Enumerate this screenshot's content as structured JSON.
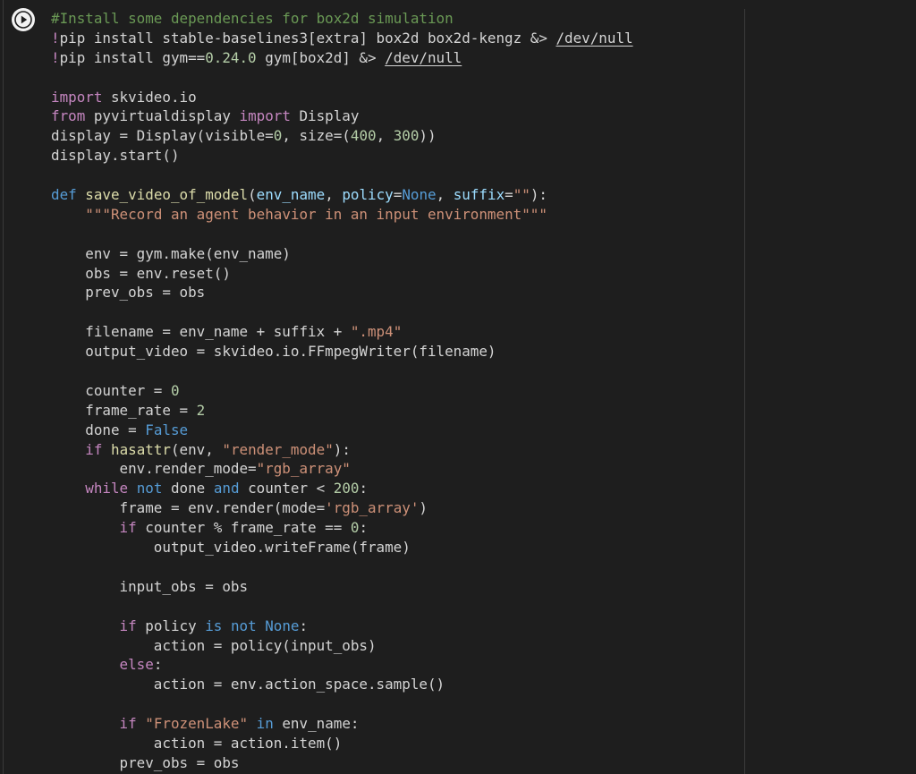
{
  "cell": {
    "run_button_label": "Run cell",
    "lines": [
      [
        {
          "t": "#Install some dependencies for box2d simulation",
          "c": "comment"
        }
      ],
      [
        {
          "t": "!",
          "c": "keyword"
        },
        {
          "t": "pip install stable-baselines3[extra] box2d box2d-kengz &> ",
          "c": "text"
        },
        {
          "t": "/dev/null",
          "c": "path"
        }
      ],
      [
        {
          "t": "!",
          "c": "keyword"
        },
        {
          "t": "pip install gym==",
          "c": "text"
        },
        {
          "t": "0.24.0",
          "c": "number"
        },
        {
          "t": " gym[box2d] &> ",
          "c": "text"
        },
        {
          "t": "/dev/null",
          "c": "path"
        }
      ],
      [],
      [
        {
          "t": "import",
          "c": "keyword"
        },
        {
          "t": " skvideo.io",
          "c": "text"
        }
      ],
      [
        {
          "t": "from",
          "c": "keyword"
        },
        {
          "t": " pyvirtualdisplay ",
          "c": "text"
        },
        {
          "t": "import",
          "c": "keyword"
        },
        {
          "t": " Display",
          "c": "text"
        }
      ],
      [
        {
          "t": "display = Display(visible=",
          "c": "text"
        },
        {
          "t": "0",
          "c": "number"
        },
        {
          "t": ", size=(",
          "c": "text"
        },
        {
          "t": "400",
          "c": "number"
        },
        {
          "t": ", ",
          "c": "text"
        },
        {
          "t": "300",
          "c": "number"
        },
        {
          "t": "))",
          "c": "text"
        }
      ],
      [
        {
          "t": "display.start()",
          "c": "text"
        }
      ],
      [],
      [
        {
          "t": "def",
          "c": "def"
        },
        {
          "t": " ",
          "c": "text"
        },
        {
          "t": "save_video_of_model",
          "c": "func"
        },
        {
          "t": "(",
          "c": "text"
        },
        {
          "t": "env_name",
          "c": "param"
        },
        {
          "t": ", ",
          "c": "text"
        },
        {
          "t": "policy",
          "c": "param"
        },
        {
          "t": "=",
          "c": "text"
        },
        {
          "t": "None",
          "c": "const"
        },
        {
          "t": ", ",
          "c": "text"
        },
        {
          "t": "suffix",
          "c": "param"
        },
        {
          "t": "=",
          "c": "text"
        },
        {
          "t": "\"\"",
          "c": "string"
        },
        {
          "t": "):",
          "c": "text"
        }
      ],
      [
        {
          "t": "    ",
          "c": "text"
        },
        {
          "t": "\"\"\"Record an agent behavior in an input environment\"\"\"",
          "c": "string"
        }
      ],
      [],
      [
        {
          "t": "    env = gym.make(env_name)",
          "c": "text"
        }
      ],
      [
        {
          "t": "    obs = env.reset()",
          "c": "text"
        }
      ],
      [
        {
          "t": "    prev_obs = obs",
          "c": "text"
        }
      ],
      [],
      [
        {
          "t": "    filename = env_name + suffix + ",
          "c": "text"
        },
        {
          "t": "\".mp4\"",
          "c": "string"
        }
      ],
      [
        {
          "t": "    output_video = skvideo.io.FFmpegWriter(filename)",
          "c": "text"
        }
      ],
      [],
      [
        {
          "t": "    counter = ",
          "c": "text"
        },
        {
          "t": "0",
          "c": "number"
        }
      ],
      [
        {
          "t": "    frame_rate = ",
          "c": "text"
        },
        {
          "t": "2",
          "c": "number"
        }
      ],
      [
        {
          "t": "    done = ",
          "c": "text"
        },
        {
          "t": "False",
          "c": "const"
        }
      ],
      [
        {
          "t": "    ",
          "c": "text"
        },
        {
          "t": "if",
          "c": "keyword"
        },
        {
          "t": " ",
          "c": "text"
        },
        {
          "t": "hasattr",
          "c": "func"
        },
        {
          "t": "(env, ",
          "c": "text"
        },
        {
          "t": "\"render_mode\"",
          "c": "string"
        },
        {
          "t": "):",
          "c": "text"
        }
      ],
      [
        {
          "t": "        env.render_mode=",
          "c": "text"
        },
        {
          "t": "\"rgb_array\"",
          "c": "string"
        }
      ],
      [
        {
          "t": "    ",
          "c": "text"
        },
        {
          "t": "while",
          "c": "keyword"
        },
        {
          "t": " ",
          "c": "text"
        },
        {
          "t": "not",
          "c": "def"
        },
        {
          "t": " done ",
          "c": "text"
        },
        {
          "t": "and",
          "c": "def"
        },
        {
          "t": " counter < ",
          "c": "text"
        },
        {
          "t": "200",
          "c": "number"
        },
        {
          "t": ":",
          "c": "text"
        }
      ],
      [
        {
          "t": "        frame = env.render(mode=",
          "c": "text"
        },
        {
          "t": "'rgb_array'",
          "c": "string"
        },
        {
          "t": ")",
          "c": "text"
        }
      ],
      [
        {
          "t": "        ",
          "c": "text"
        },
        {
          "t": "if",
          "c": "keyword"
        },
        {
          "t": " counter % frame_rate == ",
          "c": "text"
        },
        {
          "t": "0",
          "c": "number"
        },
        {
          "t": ":",
          "c": "text"
        }
      ],
      [
        {
          "t": "            output_video.writeFrame(frame)",
          "c": "text"
        }
      ],
      [],
      [
        {
          "t": "        input_obs = obs",
          "c": "text"
        }
      ],
      [],
      [
        {
          "t": "        ",
          "c": "text"
        },
        {
          "t": "if",
          "c": "keyword"
        },
        {
          "t": " policy ",
          "c": "text"
        },
        {
          "t": "is",
          "c": "def"
        },
        {
          "t": " ",
          "c": "text"
        },
        {
          "t": "not",
          "c": "def"
        },
        {
          "t": " ",
          "c": "text"
        },
        {
          "t": "None",
          "c": "const"
        },
        {
          "t": ":",
          "c": "text"
        }
      ],
      [
        {
          "t": "            action = policy(input_obs)",
          "c": "text"
        }
      ],
      [
        {
          "t": "        ",
          "c": "text"
        },
        {
          "t": "else",
          "c": "keyword"
        },
        {
          "t": ":",
          "c": "text"
        }
      ],
      [
        {
          "t": "            action = env.action_space.sample()",
          "c": "text"
        }
      ],
      [],
      [
        {
          "t": "        ",
          "c": "text"
        },
        {
          "t": "if",
          "c": "keyword"
        },
        {
          "t": " ",
          "c": "text"
        },
        {
          "t": "\"FrozenLake\"",
          "c": "string"
        },
        {
          "t": " ",
          "c": "text"
        },
        {
          "t": "in",
          "c": "def"
        },
        {
          "t": " env_name:",
          "c": "text"
        }
      ],
      [
        {
          "t": "            action = action.item()",
          "c": "text"
        }
      ],
      [
        {
          "t": "        prev_obs = obs",
          "c": "text"
        }
      ]
    ]
  },
  "icons": {
    "run": "play-icon"
  }
}
